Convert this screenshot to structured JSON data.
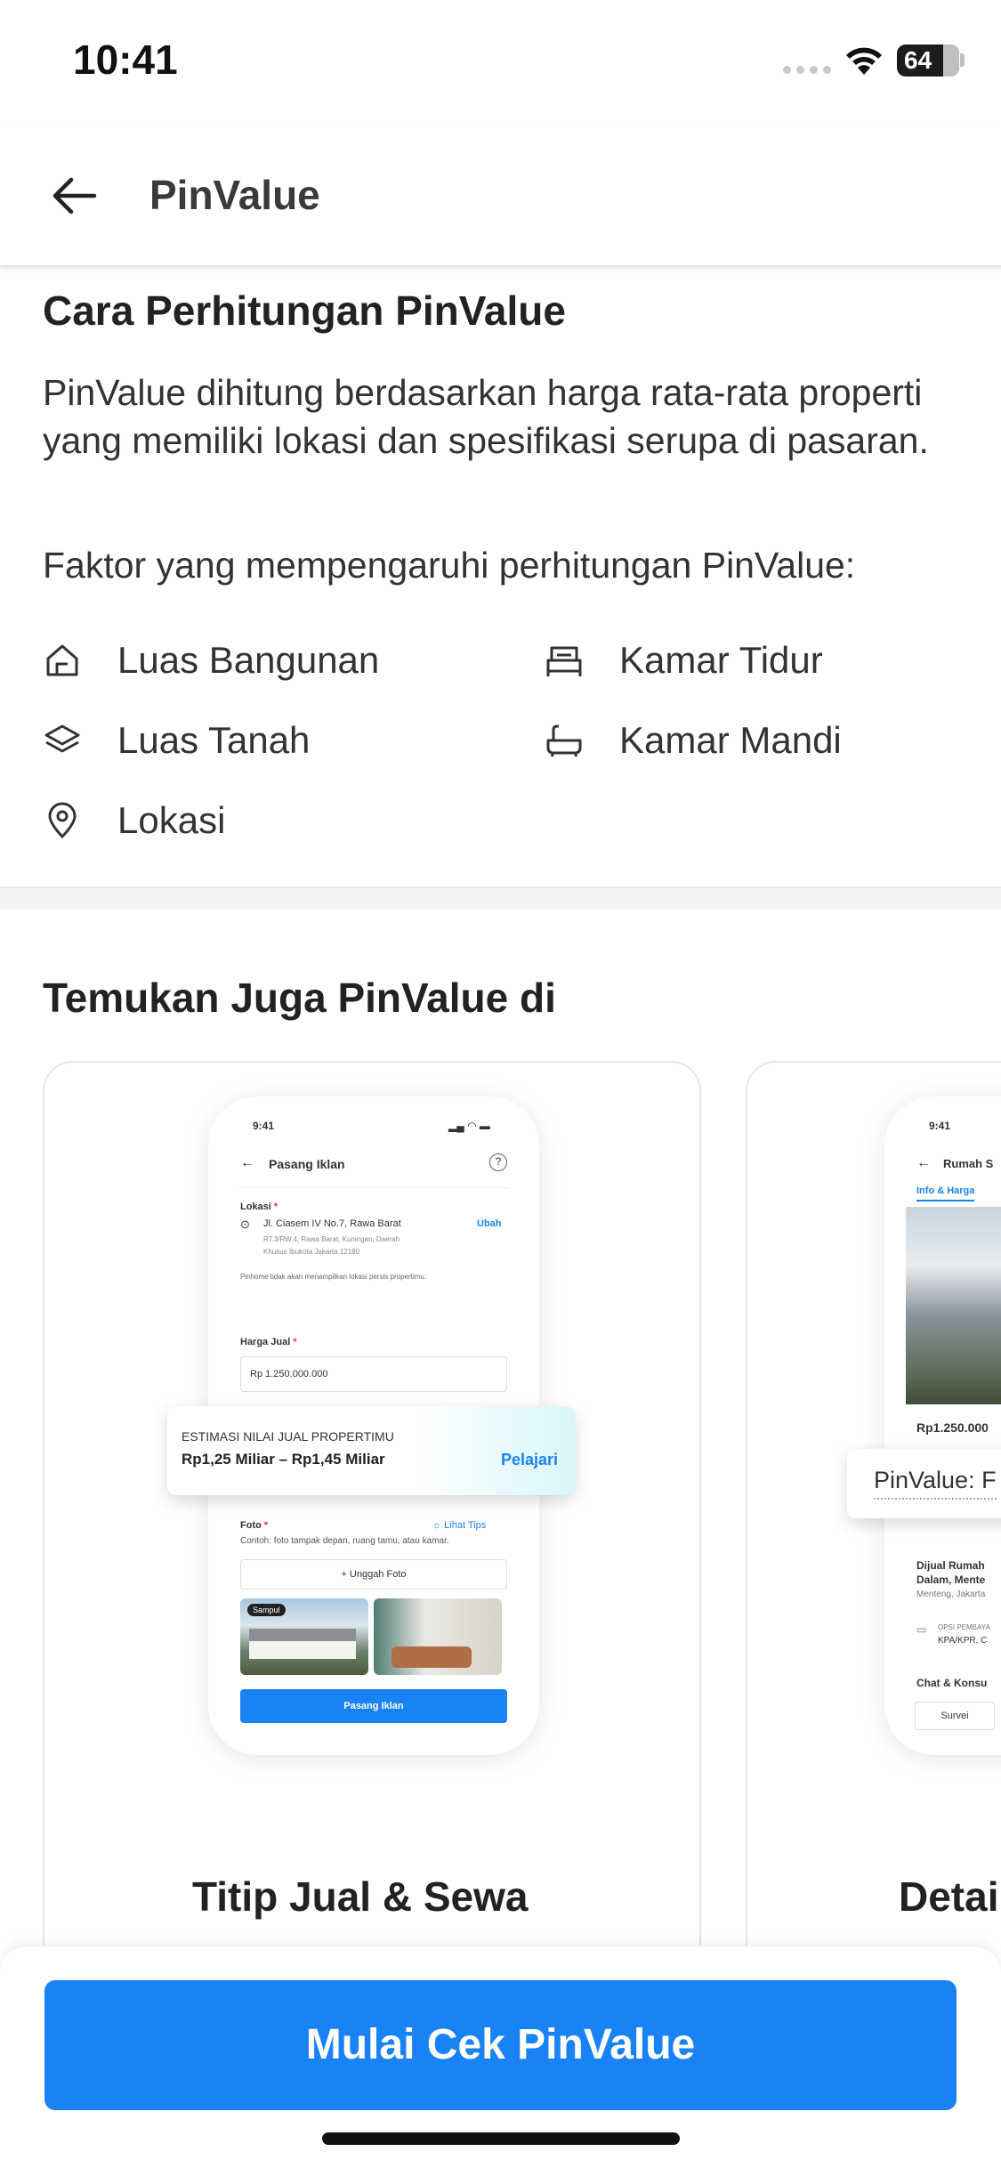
{
  "status_bar": {
    "time": "10:41",
    "battery": "64"
  },
  "app_bar": {
    "title": "PinValue"
  },
  "calculation": {
    "heading": "Cara Perhitungan PinValue",
    "description": "PinValue dihitung berdasarkan harga rata-rata properti yang memiliki lokasi dan spesifikasi serupa di pasaran.",
    "factors_intro": "Faktor yang mempengaruhi perhitungan PinValue:",
    "factors": [
      {
        "label": "Luas Bangunan",
        "icon": "house-icon"
      },
      {
        "label": "Kamar Tidur",
        "icon": "bed-icon"
      },
      {
        "label": "Luas Tanah",
        "icon": "layers-icon"
      },
      {
        "label": "Kamar Mandi",
        "icon": "bathtub-icon"
      },
      {
        "label": "Lokasi",
        "icon": "location-pin-icon"
      }
    ]
  },
  "discover": {
    "heading": "Temukan Juga PinValue di",
    "cards": [
      {
        "title": "Titip Jual & Sewa",
        "mock": {
          "time": "9:41",
          "header": "Pasang Iklan",
          "lokasi_label": "Lokasi",
          "address": "Jl. Ciasem IV No.7, Rawa Barat",
          "address_detail_1": "RT.3/RW.4, Rawa Barat, Kuningan, Daerah",
          "address_detail_2": "Khusus Ibukota Jakarta 12180",
          "change": "Ubah",
          "privacy_note": "Pinhome tidak akan menampilkan lokasi persis propertimu.",
          "price_label": "Harga Jual",
          "price_value": "Rp  1.250.000.000",
          "estimate_label": "ESTIMASI NILAI JUAL PROPERTIMU",
          "estimate_range": "Rp1,25 Miliar – Rp1,45 Miliar",
          "learn": "Pelajari",
          "photo_label": "Foto",
          "tips": "Lihat Tips",
          "photo_hint": "Contoh: foto tampak depan, ruang tamu, atau kamar.",
          "upload": "+ Unggah Foto",
          "sample": "Sampul",
          "submit": "Pasang Iklan"
        }
      },
      {
        "title": "Detai",
        "mock": {
          "time": "9:41",
          "header": "Rumah S",
          "tab": "Info & Harga",
          "price": "Rp1.250.000",
          "pinvalue": "PinValue: F",
          "listing_1": "Dijual Rumah",
          "listing_2": "Dalam, Mente",
          "listing_3": "Menteng, Jakarta",
          "payment_1": "OPSI PEMBAYA",
          "payment_2": "KPA/KPR, C",
          "chat": "Chat & Konsu",
          "survey": "Survei"
        }
      }
    ]
  },
  "cta": {
    "label": "Mulai Cek PinValue"
  },
  "colors": {
    "primary": "#1982f4",
    "text": "#222222"
  }
}
